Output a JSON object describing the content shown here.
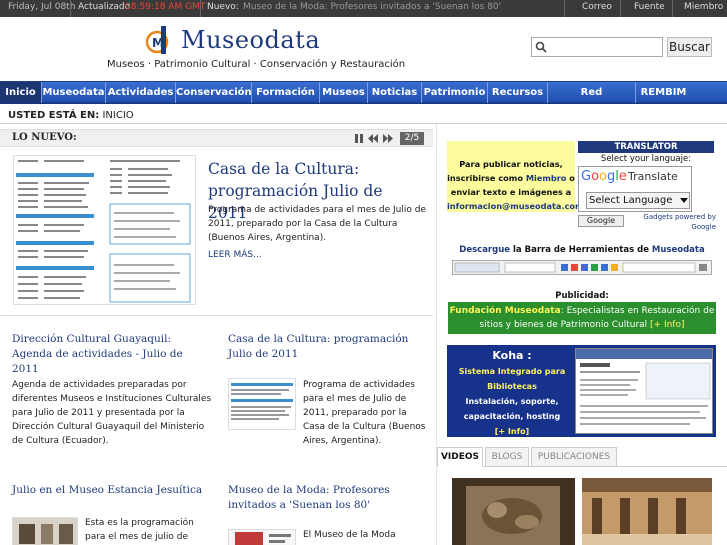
{
  "topbar": {
    "date": "Friday, Jul 08th",
    "updated_label": "Actualizado",
    "clock": "08:59:18 AM GMT",
    "news_label": "Nuevo:",
    "ticker": "Museo de la Moda: Profesores invitados a 'Suenan los 80'",
    "links": [
      "Correo",
      "Fuente",
      "Miembro"
    ]
  },
  "header": {
    "logo_text": "Museodata",
    "tagline": "Museos · Patrimonio Cultural · Conservación y Restauración",
    "search_button": "Buscar"
  },
  "nav": {
    "items": [
      "Inicio",
      "Museodata",
      "Actividades",
      "Conservación",
      "Formación",
      "Museos",
      "Noticias",
      "Patrimonio",
      "Recursos",
      "Red Profesional",
      "REMBIM"
    ]
  },
  "breadcrumb": {
    "label": "USTED ESTÁ EN:",
    "current": "INICIO"
  },
  "lonuevo": {
    "title": "LO NUEVO:",
    "counter": "2/5"
  },
  "featured": {
    "title": "Casa de la Cultura: programación Julio de 2011",
    "body": "Programa de actividades para el mes de Julio de 2011, preparado por la Casa de la Cultura (Buenos Aires, Argentina).",
    "more": "LEER MÁS..."
  },
  "articles": [
    {
      "title": "Dirección Cultural Guayaquil: Agenda de actividades - Julio de 2011",
      "body": "Agenda de actividades preparadas por diferentes Museos e Instituciones Culturales para Julio de 2011 y presentada por la Dirección Cultural Guayaquil del Ministerio de Cultura (Ecuador)."
    },
    {
      "title": "Casa de la Cultura: programación Julio de 2011",
      "body": "Programa de actividades para el mes de Julio de 2011, preparado por la Casa de la Cultura (Buenos Aires, Argentina)."
    },
    {
      "title": "Julio en el Museo Estancia Jesuítica",
      "body": "Esta es la programación para el mes de julio de"
    },
    {
      "title": "Museo de la Moda: Profesores invitados a 'Suenan los 80'",
      "body": "El Museo de la Moda"
    }
  ],
  "sidebar": {
    "publish_text": [
      "Para publicar noticias,",
      "inscribirse como ",
      "Miembro",
      " o",
      "enviar texto e imágenes a",
      "informacion@museodata.com"
    ],
    "translator_title": "TRANSLATOR",
    "translator_prompt": "Select your languaje:",
    "gt_word": "Translate",
    "language_select": "Select Language",
    "google_button": "Google",
    "gadgets": "Gadgets powered by Google",
    "download_prefix": "Descargue",
    "download_text": " la Barra de Herramientas de ",
    "download_brand": "Museodata",
    "publicidad": "Publicidad:",
    "fundacion_name": "Fundación Museodata",
    "fundacion_text": ": Especialistas en Restauración de sitios y bienes de Patrimonio Cultural ",
    "fundacion_more": "[+ Info]",
    "koha_title": "Koha :",
    "koha_lines": [
      "Sistema Integrado para",
      "Bibliotecas",
      "Instalación, soporte,",
      "capacitación, hosting",
      "[+ Info]"
    ]
  },
  "tabs": [
    "VIDEOS",
    "BLOGS",
    "PUBLICACIONES"
  ],
  "colors": {
    "brand_blue": "#1e3a7c",
    "nav_blue": "#2a5ec4",
    "clock_red": "#e8463a",
    "publish_yellow": "#fcfc9f",
    "fundacion_green": "#2b8f2e",
    "koha_blue": "#16328a"
  }
}
